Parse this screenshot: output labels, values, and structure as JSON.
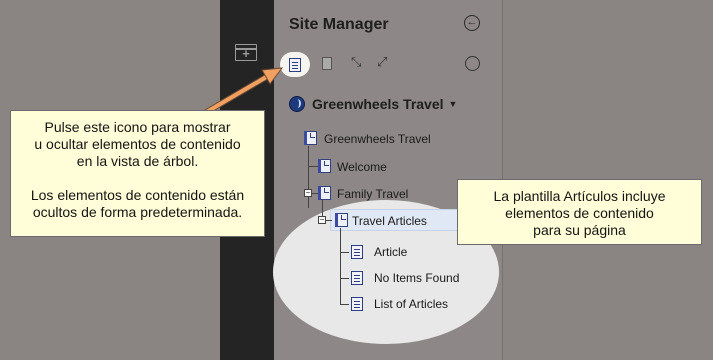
{
  "panel": {
    "title": "Site Manager",
    "site_name": "Greenwheels Travel"
  },
  "tree": {
    "root": "Greenwheels Travel",
    "welcome": "Welcome",
    "family_travel": "Family Travel",
    "travel_articles": "Travel Articles",
    "article": "Article",
    "no_items_found": "No Items Found",
    "list_of_articles": "List of Articles"
  },
  "callouts": {
    "left_line1": "Pulse este icono para mostrar",
    "left_line2": "u ocultar elementos de contenido",
    "left_line3": "en la vista de árbol.",
    "left_line4": "Los elementos de contenido están",
    "left_line5": "ocultos de forma predeterminada.",
    "right_line1": "La plantilla Artículos incluye",
    "right_line2": "elementos de contenido",
    "right_line3": "para su página"
  },
  "colors": {
    "callout_bg": "#fffed8",
    "arrow": "#f0a060",
    "rail": "#242424",
    "selection": "#dfe8f4"
  }
}
